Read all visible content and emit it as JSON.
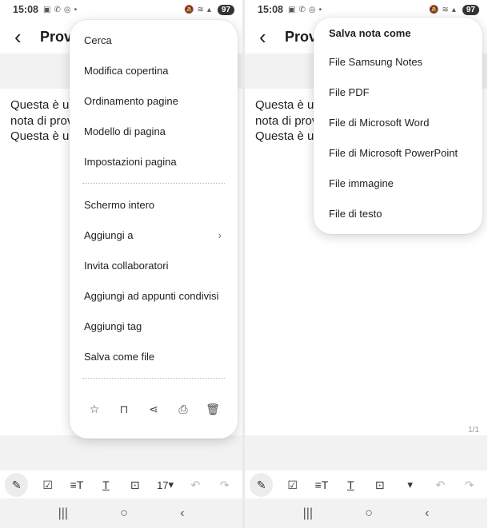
{
  "status": {
    "time": "15:08",
    "battery": "97"
  },
  "note": {
    "title": "Prova",
    "lines": [
      "Questa è un",
      "nota di prov",
      "Questa è un"
    ]
  },
  "left_menu": {
    "items": [
      "Cerca",
      "Modifica copertina",
      "Ordinamento pagine",
      "Modello di pagina",
      "Impostazioni pagina",
      "Schermo intero",
      "Aggiungi a",
      "Invita collaboratori",
      "Aggiungi ad appunti condivisi",
      "Aggiungi tag",
      "Salva come file"
    ],
    "icons": [
      "star-icon",
      "lock-icon",
      "share-icon",
      "print-icon",
      "trash-icon"
    ]
  },
  "right_menu": {
    "header": "Salva nota come",
    "items": [
      "File Samsung Notes",
      "File PDF",
      "File di Microsoft Word",
      "File di Microsoft PowerPoint",
      "File immagine",
      "File di testo"
    ]
  },
  "page_indicator": "1/1",
  "toolbar": {
    "font_size": "17"
  }
}
